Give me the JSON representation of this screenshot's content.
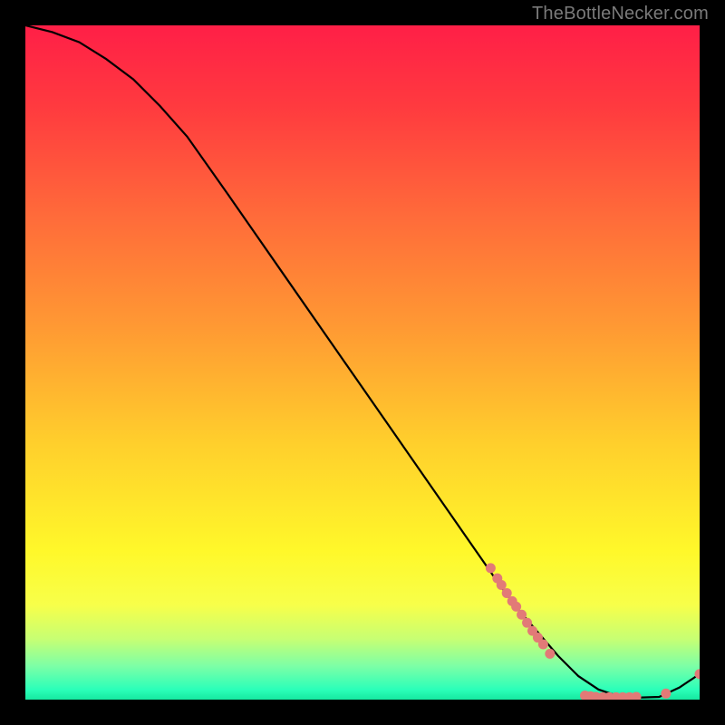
{
  "watermark": "TheBottleNecker.com",
  "gradient": {
    "stops": [
      {
        "offset": 0.0,
        "color": "#ff1f47"
      },
      {
        "offset": 0.12,
        "color": "#ff3a3f"
      },
      {
        "offset": 0.28,
        "color": "#ff6a3a"
      },
      {
        "offset": 0.45,
        "color": "#ff9a33"
      },
      {
        "offset": 0.62,
        "color": "#ffcf2c"
      },
      {
        "offset": 0.78,
        "color": "#fff82a"
      },
      {
        "offset": 0.86,
        "color": "#f7ff4a"
      },
      {
        "offset": 0.91,
        "color": "#c7ff73"
      },
      {
        "offset": 0.95,
        "color": "#7dffa6"
      },
      {
        "offset": 0.985,
        "color": "#2bffb9"
      },
      {
        "offset": 1.0,
        "color": "#16e8a0"
      }
    ]
  },
  "chart_data": {
    "type": "line",
    "title": "",
    "xlabel": "",
    "ylabel": "",
    "xlim": [
      0,
      100
    ],
    "ylim": [
      0,
      100
    ],
    "series": [
      {
        "name": "curve",
        "x": [
          0,
          4,
          8,
          12,
          16,
          20,
          24,
          30,
          38,
          46,
          54,
          62,
          70,
          73,
          76,
          79,
          82,
          85,
          88,
          91,
          94,
          97,
          100
        ],
        "y": [
          100,
          99,
          97.5,
          95,
          92,
          88,
          83.5,
          75,
          63.5,
          52,
          40.5,
          29,
          17.5,
          13.5,
          10,
          6.5,
          3.5,
          1.5,
          0.5,
          0.3,
          0.4,
          1.8,
          3.8
        ]
      }
    ],
    "markers": {
      "name": "cluster-points",
      "color": "#e27a77",
      "points": [
        {
          "x": 69.0,
          "y": 19.5
        },
        {
          "x": 70.0,
          "y": 18.0
        },
        {
          "x": 70.6,
          "y": 17.0
        },
        {
          "x": 71.4,
          "y": 15.8
        },
        {
          "x": 72.2,
          "y": 14.6
        },
        {
          "x": 72.8,
          "y": 13.8
        },
        {
          "x": 73.6,
          "y": 12.6
        },
        {
          "x": 74.4,
          "y": 11.4
        },
        {
          "x": 75.2,
          "y": 10.2
        },
        {
          "x": 76.0,
          "y": 9.2
        },
        {
          "x": 76.8,
          "y": 8.2
        },
        {
          "x": 77.8,
          "y": 6.8
        },
        {
          "x": 83.0,
          "y": 0.6
        },
        {
          "x": 83.8,
          "y": 0.5
        },
        {
          "x": 84.6,
          "y": 0.4
        },
        {
          "x": 85.6,
          "y": 0.35
        },
        {
          "x": 86.6,
          "y": 0.35
        },
        {
          "x": 87.6,
          "y": 0.35
        },
        {
          "x": 88.6,
          "y": 0.35
        },
        {
          "x": 89.6,
          "y": 0.35
        },
        {
          "x": 90.6,
          "y": 0.4
        },
        {
          "x": 95.0,
          "y": 0.9
        },
        {
          "x": 100.0,
          "y": 3.8
        }
      ]
    }
  }
}
